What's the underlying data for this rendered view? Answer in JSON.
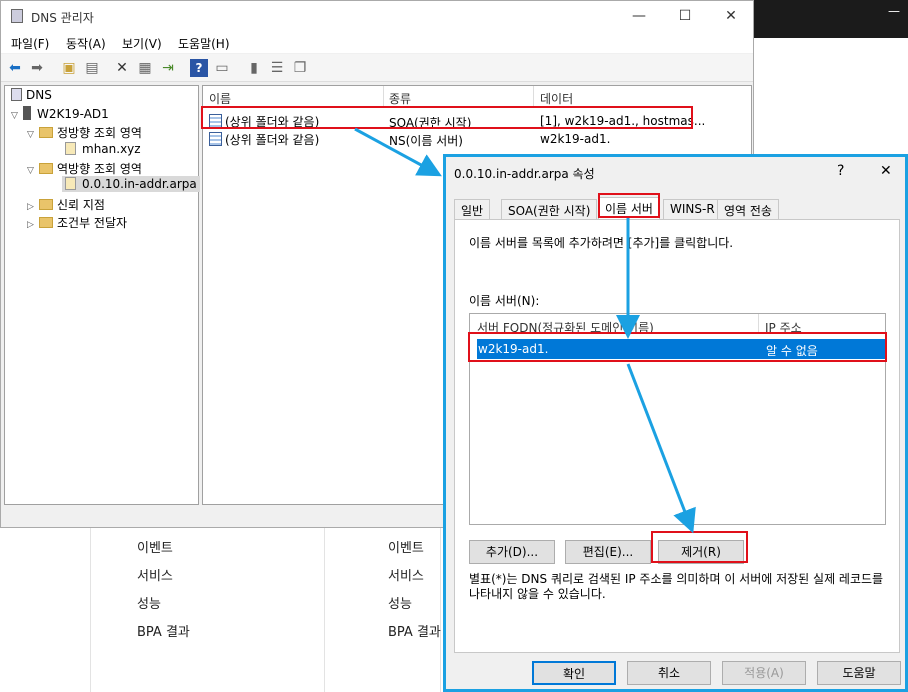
{
  "window": {
    "title": "DNS 관리자",
    "controls": {
      "minimize": "—",
      "maximize": "☐",
      "close": "✕"
    }
  },
  "menu": [
    "파일(F)",
    "동작(A)",
    "보기(V)",
    "도움말(H)"
  ],
  "toolbar": {
    "icons": [
      "back-arrow-icon",
      "forward-arrow-icon",
      "up-folder-icon",
      "show-hide-tree-icon",
      "delete-icon",
      "properties-icon",
      "export-icon",
      "help-icon",
      "console-icon",
      "server-icon",
      "list-icon",
      "copy-icon"
    ]
  },
  "tree": {
    "root": "DNS",
    "server": "W2K19-AD1",
    "forward_zone": "정방향 조회 영역",
    "forward_child": "mhan.xyz",
    "reverse_zone": "역방향 조회 영역",
    "reverse_child": "0.0.10.in-addr.arpa",
    "trust_points": "신뢰 지점",
    "conditional_forwarders": "조건부 전달자"
  },
  "records": {
    "columns": [
      "이름",
      "종류",
      "데이터"
    ],
    "rows": [
      {
        "name": "(상위 폴더와 같음)",
        "type": "SOA(권한 시작)",
        "data": "[1], w2k19-ad1., hostmas..."
      },
      {
        "name": "(상위 폴더와 같음)",
        "type": "NS(이름 서버)",
        "data": "w2k19-ad1."
      }
    ]
  },
  "background_panel": {
    "left_items": [
      "이벤트",
      "서비스",
      "성능",
      "BPA 결과"
    ],
    "right_items": [
      "이벤트",
      "서비스",
      "성능",
      "BPA 결과"
    ]
  },
  "dialog": {
    "title": "0.0.10.in-addr.arpa 속성",
    "help": "?",
    "close": "✕",
    "tabs": [
      "일반",
      "SOA(권한 시작)",
      "이름 서버",
      "WINS-R",
      "영역 전송"
    ],
    "active_tab": "이름 서버",
    "instruction": "이름 서버를 목록에 추가하려면 [추가]를 클릭합니다.",
    "list_label": "이름 서버(N):",
    "list_columns": [
      "서버 FQDN(정규화된 도메인 이름)",
      "IP 주소"
    ],
    "list_rows": [
      {
        "fqdn": "w2k19-ad1.",
        "ip": "알 수 없음"
      }
    ],
    "buttons": {
      "add": "추가(D)...",
      "edit": "편집(E)...",
      "remove": "제거(R)"
    },
    "note": "별표(*)는 DNS 쿼리로 검색된 IP 주소를 의미하며 이 서버에 저장된 실제 레코드를 나타내지 않을 수 있습니다.",
    "footer": {
      "ok": "확인",
      "cancel": "취소",
      "apply": "적용(A)",
      "help": "도움말"
    }
  },
  "colors": {
    "accent": "#0078d7",
    "highlight_box": "#e0101a",
    "arrow": "#1ba1e2"
  }
}
